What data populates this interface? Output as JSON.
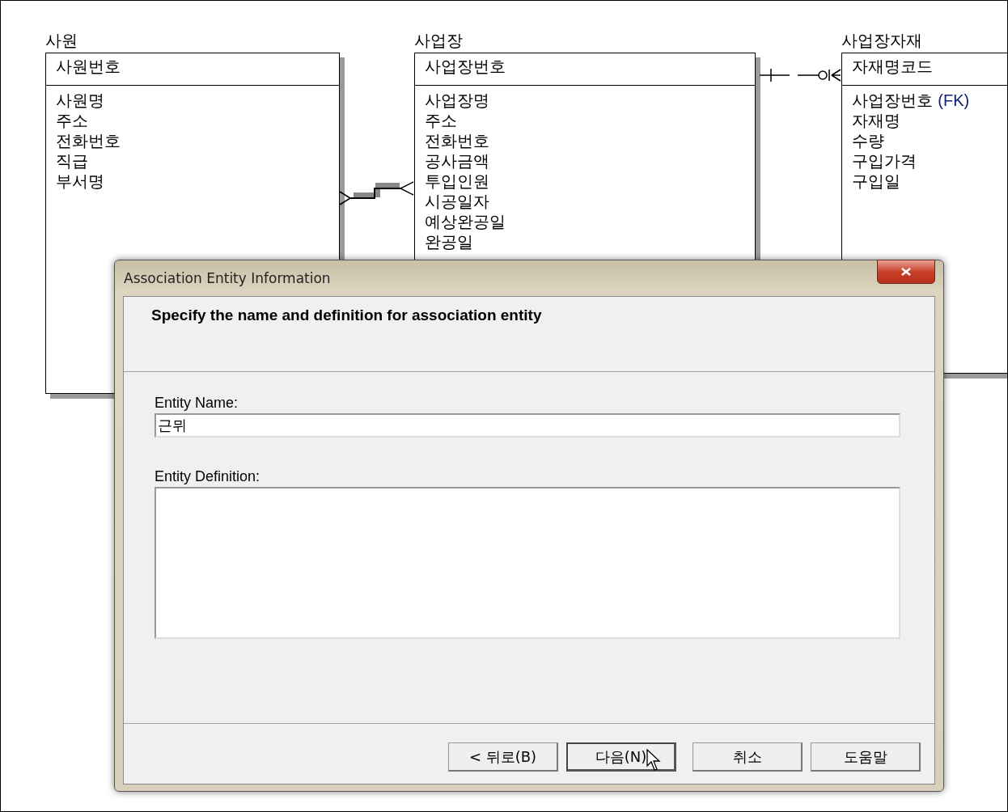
{
  "diagram": {
    "entities": [
      {
        "name": "사원",
        "keys": [
          "사원번호"
        ],
        "attributes": [
          {
            "name": "사원명"
          },
          {
            "name": "주소"
          },
          {
            "name": "전화번호"
          },
          {
            "name": "직급"
          },
          {
            "name": "부서명"
          }
        ]
      },
      {
        "name": "사업장",
        "keys": [
          "사업장번호"
        ],
        "attributes": [
          {
            "name": "사업장명"
          },
          {
            "name": "주소"
          },
          {
            "name": "전화번호"
          },
          {
            "name": "공사금액"
          },
          {
            "name": "투입인원"
          },
          {
            "name": "시공일자"
          },
          {
            "name": "예상완공일"
          },
          {
            "name": "완공일"
          }
        ]
      },
      {
        "name": "사업장자재",
        "keys": [
          "자재명코드"
        ],
        "attributes": [
          {
            "name": "사업장번호",
            "suffix": "(FK)"
          },
          {
            "name": "자재명"
          },
          {
            "name": "수량"
          },
          {
            "name": "구입가격"
          },
          {
            "name": "구입일"
          }
        ]
      }
    ],
    "relationships": [
      {
        "kind": "many-to-many"
      },
      {
        "kind": "one-to-many"
      }
    ]
  },
  "dialog": {
    "title": "Association Entity Information",
    "heading": "Specify the name and definition for association entity",
    "fields": [
      {
        "kind": "line",
        "label": "Entity Name:",
        "value": "근뮈"
      },
      {
        "kind": "area",
        "label": "Entity Definition:"
      }
    ],
    "buttons": [
      {
        "label": "< 뒤로(B)",
        "focused": false
      },
      {
        "label": "다음(N)",
        "focused": true
      },
      {
        "label": "취소",
        "focused": false
      },
      {
        "label": "도움말",
        "focused": false
      }
    ]
  }
}
